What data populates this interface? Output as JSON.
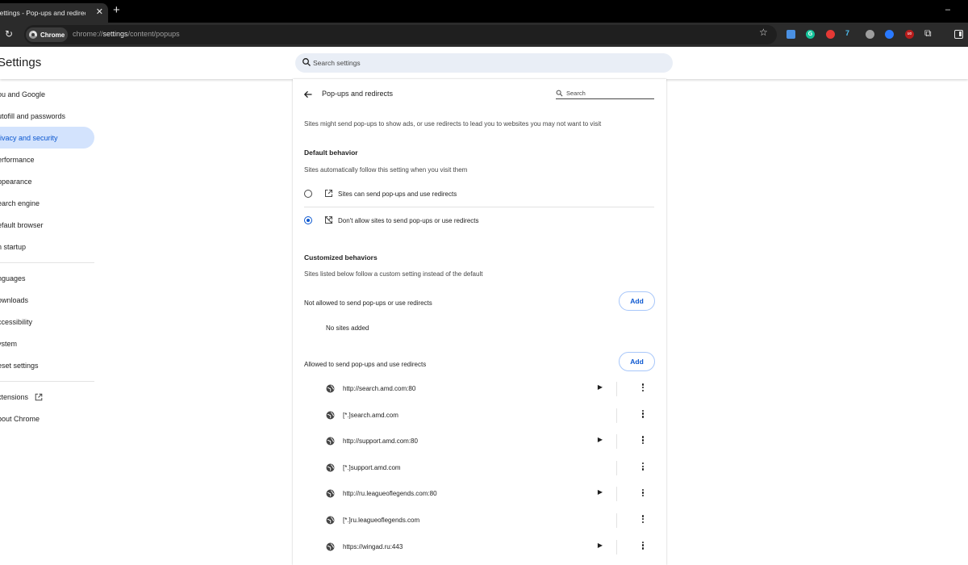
{
  "browser": {
    "tab_title": "Settings - Pop-ups and redirects",
    "tab_close": "✕",
    "new_tab": "+",
    "minimize": "–",
    "chip_label": "Chrome",
    "url_prefix": "chrome://",
    "url_host": "settings",
    "url_path": "/content/popups",
    "extension_g": "G",
    "extension_7": "7",
    "extension_ub": "uo"
  },
  "header": {
    "title": "Settings",
    "search_placeholder": "Search settings"
  },
  "sidebar": {
    "items": [
      {
        "label": "ou and Google"
      },
      {
        "label": "utofill and passwords"
      },
      {
        "label": "rivacy and security"
      },
      {
        "label": "erformance"
      },
      {
        "label": "ppearance"
      },
      {
        "label": "earch engine"
      },
      {
        "label": "efault browser"
      },
      {
        "label": "n startup"
      },
      {
        "label": "nguages"
      },
      {
        "label": "ownloads"
      },
      {
        "label": "ccessibility"
      },
      {
        "label": "ystem"
      },
      {
        "label": "eset settings"
      },
      {
        "label": "xtensions"
      },
      {
        "label": "bout Chrome"
      }
    ],
    "active_index": 2
  },
  "page": {
    "title": "Pop-ups and redirects",
    "search_placeholder": "Search",
    "description": "Sites might send pop-ups to show ads, or use redirects to lead you to websites you may not want to visit",
    "default_heading": "Default behavior",
    "default_sub": "Sites automatically follow this setting when you visit them",
    "option_allow": "Sites can send pop-ups and use redirects",
    "option_block": "Don't allow sites to send pop-ups or use redirects",
    "selected_option": "block",
    "custom_heading": "Customized behaviors",
    "custom_sub": "Sites listed below follow a custom setting instead of the default",
    "blocked_label": "Not allowed to send pop-ups or use redirects",
    "blocked_add": "Add",
    "blocked_empty": "No sites added",
    "allowed_label": "Allowed to send pop-ups and use redirects",
    "allowed_add": "Add",
    "allowed_sites": [
      {
        "url": "http://search.amd.com:80",
        "has_arrow": true
      },
      {
        "url": "[*.]search.amd.com",
        "has_arrow": false
      },
      {
        "url": "http://support.amd.com:80",
        "has_arrow": true
      },
      {
        "url": "[*.]support.amd.com",
        "has_arrow": false
      },
      {
        "url": "http://ru.leagueoflegends.com:80",
        "has_arrow": true
      },
      {
        "url": "[*.]ru.leagueoflegends.com",
        "has_arrow": false
      },
      {
        "url": "https://wingad.ru:443",
        "has_arrow": true
      }
    ]
  },
  "colors": {
    "accent": "#0b57d0",
    "active_nav_bg": "#d3e3fd",
    "chrome_dark": "#2b2b2b"
  }
}
